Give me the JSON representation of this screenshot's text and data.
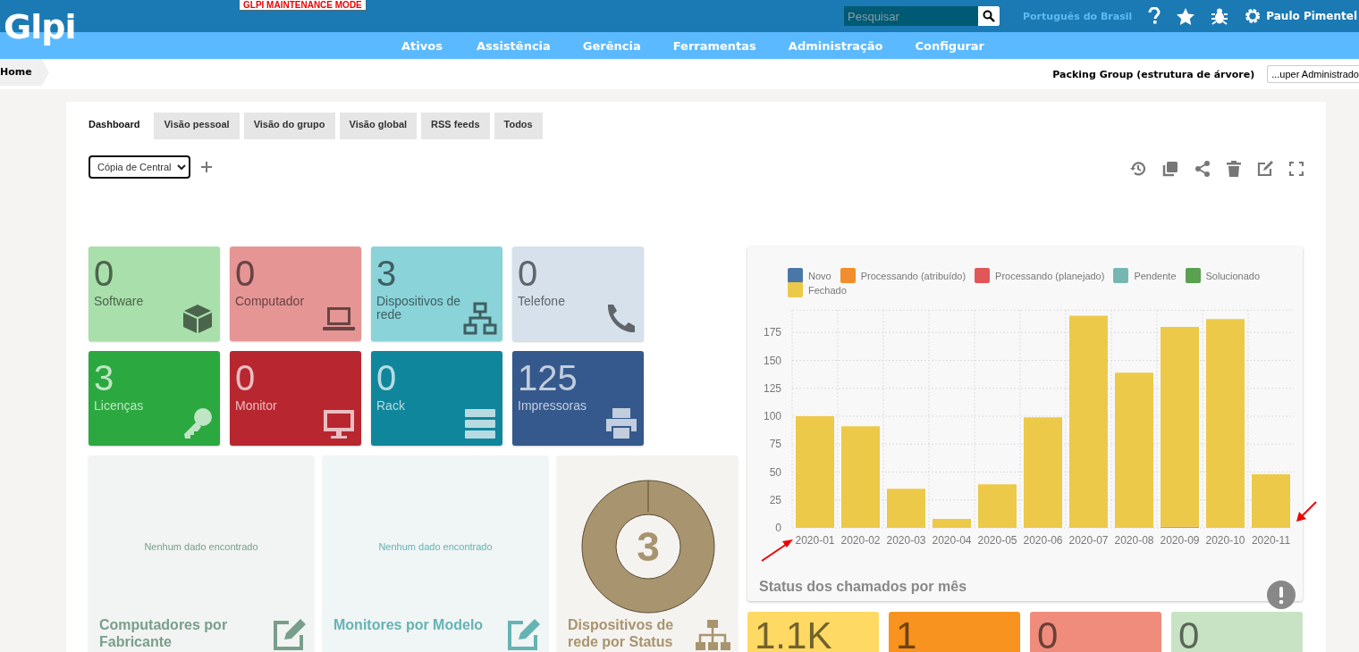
{
  "header": {
    "maintenance_banner": "GLPI MAINTENANCE MODE",
    "logo": "Glpi",
    "search": {
      "placeholder": "Pesquisar"
    },
    "language": "Português do Brasil",
    "user": "Paulo Pimentel"
  },
  "menu": [
    {
      "label": "Ativos"
    },
    {
      "label": "Assistência"
    },
    {
      "label": "Gerência"
    },
    {
      "label": "Ferramentas"
    },
    {
      "label": "Administração"
    },
    {
      "label": "Configurar"
    }
  ],
  "breadcrumb": {
    "home": "Home",
    "entity": "Packing Group (estrutura de árvore)",
    "profile": "...uper Administrado"
  },
  "tabs": [
    {
      "label": "Dashboard",
      "selected": true
    },
    {
      "label": "Visão pessoal",
      "selected": false
    },
    {
      "label": "Visão do grupo",
      "selected": false
    },
    {
      "label": "Visão global",
      "selected": false
    },
    {
      "label": "RSS feeds",
      "selected": false
    },
    {
      "label": "Todos",
      "selected": false
    }
  ],
  "dashboard_select": {
    "value": "Cópia de Central"
  },
  "tiles": [
    {
      "value": "0",
      "label": "Software",
      "kind": "cube",
      "color": "#a9dfaa"
    },
    {
      "value": "0",
      "label": "Computador",
      "kind": "laptop",
      "color": "#e69595"
    },
    {
      "value": "3",
      "label": "Dispositivos de rede",
      "kind": "network",
      "color": "#8ad3d9"
    },
    {
      "value": "0",
      "label": "Telefone",
      "kind": "phone",
      "color": "#d6e1ec"
    },
    {
      "value": "3",
      "label": "Licenças",
      "kind": "key",
      "color": "#2ba83f"
    },
    {
      "value": "0",
      "label": "Monitor",
      "kind": "monitor",
      "color": "#b8262f"
    },
    {
      "value": "0",
      "label": "Rack",
      "kind": "server",
      "color": "#10869c"
    },
    {
      "value": "125",
      "label": "Impressoras",
      "kind": "printer",
      "color": "#35598c"
    }
  ],
  "widgets": [
    {
      "kind": "empty",
      "message": "Nenhum dado encontrado",
      "title": "Computadores por Fabricante",
      "color": "#7a9e8c"
    },
    {
      "kind": "empty",
      "message": "Nenhum dado encontrado",
      "title": "Monitores por Modelo",
      "color": "#66b3b3"
    },
    {
      "kind": "donut",
      "value": "3",
      "title": "Dispositivos de rede por Status",
      "color": "#a8946f"
    }
  ],
  "chart_card": {
    "title": "Status dos chamados por mês",
    "chart_data": {
      "type": "bar",
      "stacked": true,
      "grid": true,
      "legend": true,
      "ylim": [
        0,
        195
      ],
      "categories": [
        "2020-01",
        "2020-02",
        "2020-03",
        "2020-04",
        "2020-05",
        "2020-06",
        "2020-07",
        "2020-08",
        "2020-09",
        "2020-10",
        "2020-11"
      ],
      "yticks": [
        0,
        25,
        50,
        75,
        100,
        125,
        150,
        175
      ],
      "series": [
        {
          "name": "Novo",
          "color": "#4b76a8",
          "values": [
            0,
            0,
            0,
            0,
            0,
            0,
            0,
            0,
            0,
            0,
            0
          ]
        },
        {
          "name": "Processando (atribuído)",
          "color": "#f28d2c",
          "values": [
            0,
            0,
            0,
            0,
            0,
            0,
            0,
            0,
            1,
            0,
            0
          ]
        },
        {
          "name": "Processando (planejado)",
          "color": "#e15759",
          "values": [
            0,
            0,
            0,
            0,
            0,
            0,
            0,
            0,
            0,
            0,
            0
          ]
        },
        {
          "name": "Pendente",
          "color": "#76b7b2",
          "values": [
            0,
            0,
            0,
            0,
            0,
            0,
            0,
            0,
            0,
            0,
            0
          ]
        },
        {
          "name": "Solucionado",
          "color": "#59a14f",
          "values": [
            0,
            0,
            0,
            0,
            0,
            0,
            0,
            0,
            0,
            0,
            0
          ]
        },
        {
          "name": "Fechado",
          "color": "#edc949",
          "values": [
            100,
            91,
            35,
            8,
            39,
            99,
            190,
            139,
            179,
            187,
            48
          ]
        }
      ]
    }
  },
  "counters": [
    {
      "value": "1.1K",
      "color": "#fed964"
    },
    {
      "value": "1",
      "color": "#f7931e"
    },
    {
      "value": "0",
      "color": "#f08c7c"
    },
    {
      "value": "0",
      "color": "#c8e3c4"
    }
  ]
}
